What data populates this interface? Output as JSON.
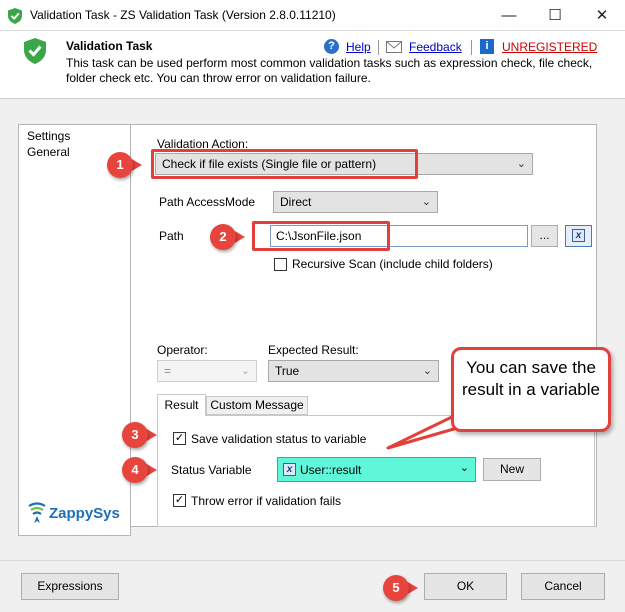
{
  "window": {
    "title": "Validation Task - ZS Validation Task (Version 2.8.0.11210)",
    "minimize": "—",
    "maximize": "☐",
    "close": "✕"
  },
  "header": {
    "title": "Validation Task",
    "description": "This task can be used perform most common validation tasks such as expression check, file check, folder check etc. You can throw error on validation failure.",
    "help_icon": "?",
    "help_label": "Help",
    "feedback_label": "Feedback",
    "info_icon": "i",
    "unregistered_label": "UNREGISTERED"
  },
  "nav": {
    "items": [
      {
        "label": "Settings"
      },
      {
        "label": "General"
      }
    ]
  },
  "form": {
    "validation_action_label": "Validation Action:",
    "validation_action_value": "Check if file exists (Single file or pattern)",
    "path_access_mode_label": "Path AccessMode",
    "path_access_mode_value": "Direct",
    "path_label": "Path",
    "path_value": "C:\\JsonFile.json",
    "browse_label": "...",
    "expr_icon": "x",
    "recursive_scan_label": "Recursive Scan (include child folders)",
    "recursive_scan_checked": false,
    "operator_label": "Operator:",
    "operator_value": "=",
    "expected_result_label": "Expected Result:",
    "expected_result_value": "True"
  },
  "tabs": [
    {
      "label": "Result",
      "active": true
    },
    {
      "label": "Custom Message",
      "active": false
    }
  ],
  "result_tab": {
    "save_status_label": "Save validation status to variable",
    "save_status_checked": true,
    "status_variable_label": "Status Variable",
    "status_variable_value": "User::result",
    "status_variable_icon": "x",
    "new_button_label": "New",
    "throw_error_label": "Throw error if validation fails",
    "throw_error_checked": true
  },
  "annotations": {
    "badges": [
      "1",
      "2",
      "3",
      "4",
      "5"
    ],
    "callout_text": "You can save the result in a variable",
    "accent_color": "#e8443e"
  },
  "brand": {
    "logo_text": "ZappySys",
    "logo_color": "#1f6fb8",
    "logo_accent": "#7cc242"
  },
  "footer": {
    "expressions_label": "Expressions",
    "ok_label": "OK",
    "cancel_label": "Cancel"
  }
}
